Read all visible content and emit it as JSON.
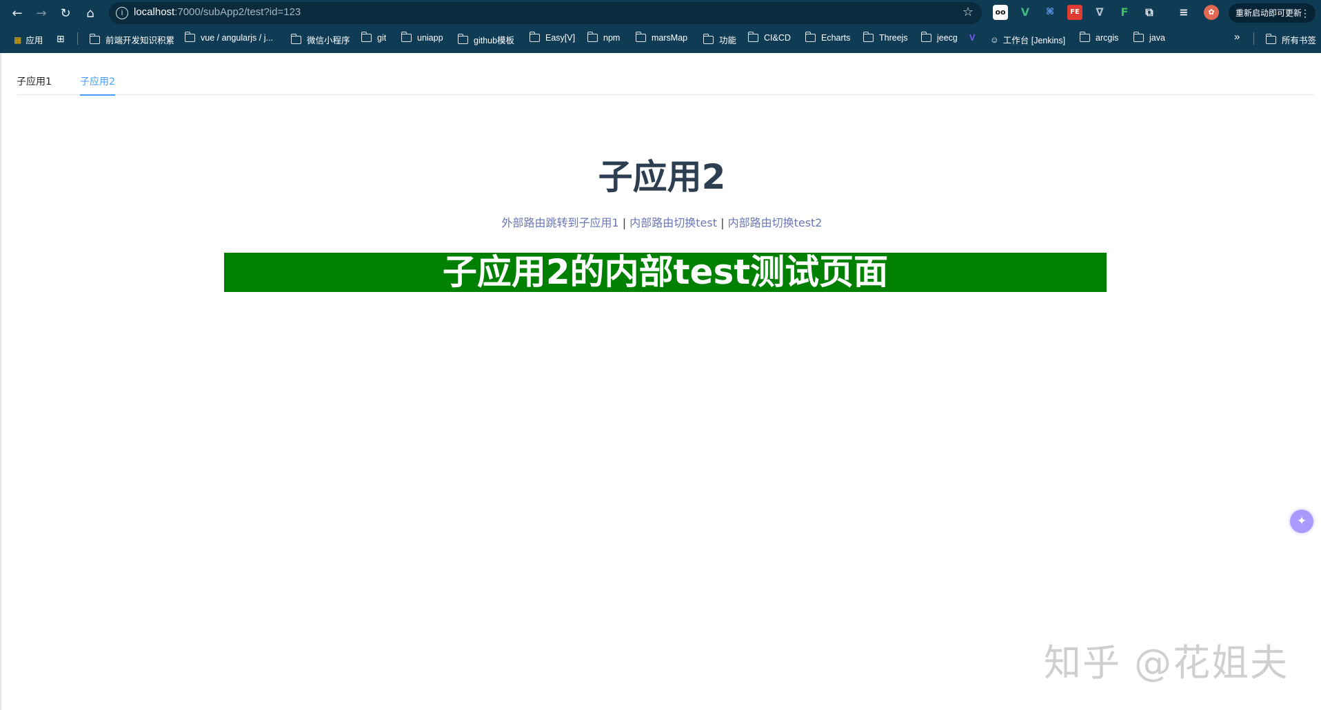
{
  "browser": {
    "url_host": "localhost",
    "url_rest": ":7000/subApp2/test?id=123",
    "update_label": "重新启动即可更新",
    "bookmarks": [
      "应用",
      "前端开发知识积累",
      "vue / angularjs / j...",
      "微信小程序",
      "git",
      "uniapp",
      "github模板",
      "Easy[V]",
      "npm",
      "marsMap",
      "功能",
      "CI&CD",
      "Echarts",
      "Threejs",
      "jeecg",
      "工作台 [Jenkins]",
      "arcgis",
      "java",
      "所有书签"
    ],
    "more_label": "»"
  },
  "tabs": [
    {
      "label": "子应用1",
      "active": false
    },
    {
      "label": "子应用2",
      "active": true
    }
  ],
  "content": {
    "title": "子应用2",
    "links": [
      "外部路由跳转到子应用1",
      "内部路由切换test",
      "内部路由切换test2"
    ],
    "separator": "|",
    "green_heading": "子应用2的内部test测试页面"
  },
  "watermark": "知乎 @花姐夫",
  "colors": {
    "toolbar": "#0f3b55",
    "accent": "#409eff",
    "green": "#008000"
  }
}
